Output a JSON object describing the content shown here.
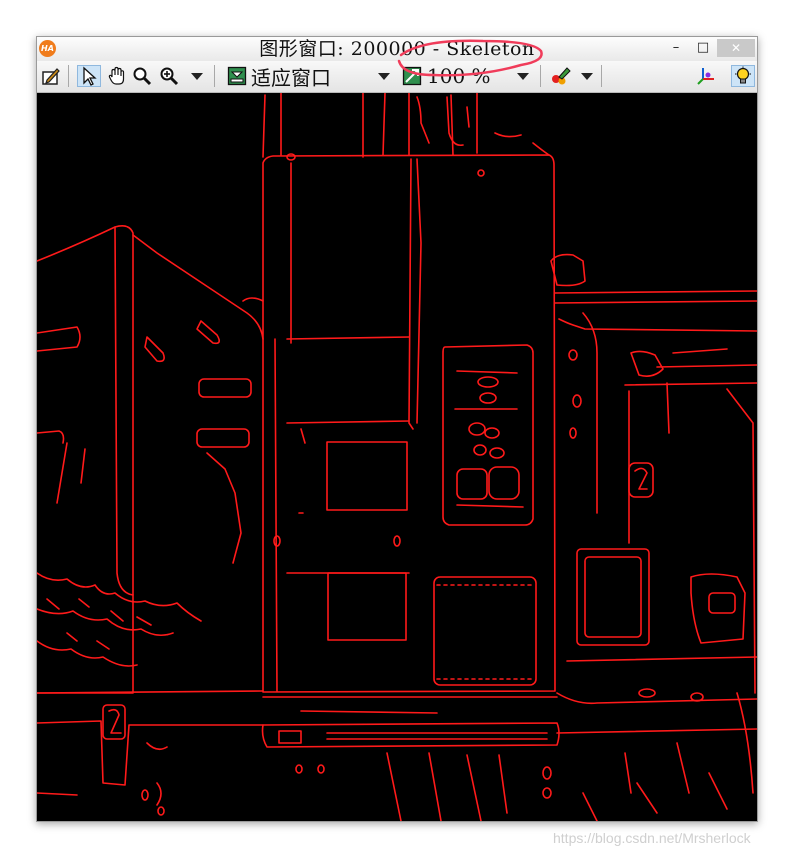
{
  "window": {
    "app_icon_text": "HA",
    "title": "图形窗口: 200000 - Skeleton",
    "min_glyph": "–",
    "max_glyph": "□",
    "close_glyph": "✕"
  },
  "toolbar": {
    "fit_label": "适应窗口",
    "zoom_value": "100 %"
  },
  "icons": [
    "edit-icon",
    "pointer-icon",
    "hand-icon",
    "zoom-icon",
    "zoom-in-icon",
    "dropdown-arrow-icon",
    "fit-window-icon",
    "zoom-percent-icon",
    "color-tool-icon",
    "axes-icon",
    "lightbulb-icon"
  ],
  "colors": {
    "edges": "#ff1a1a",
    "canvas": "#000000",
    "annotation": "#f03c5a"
  },
  "watermark": "https://blog.csdn.net/Mrsherlock"
}
